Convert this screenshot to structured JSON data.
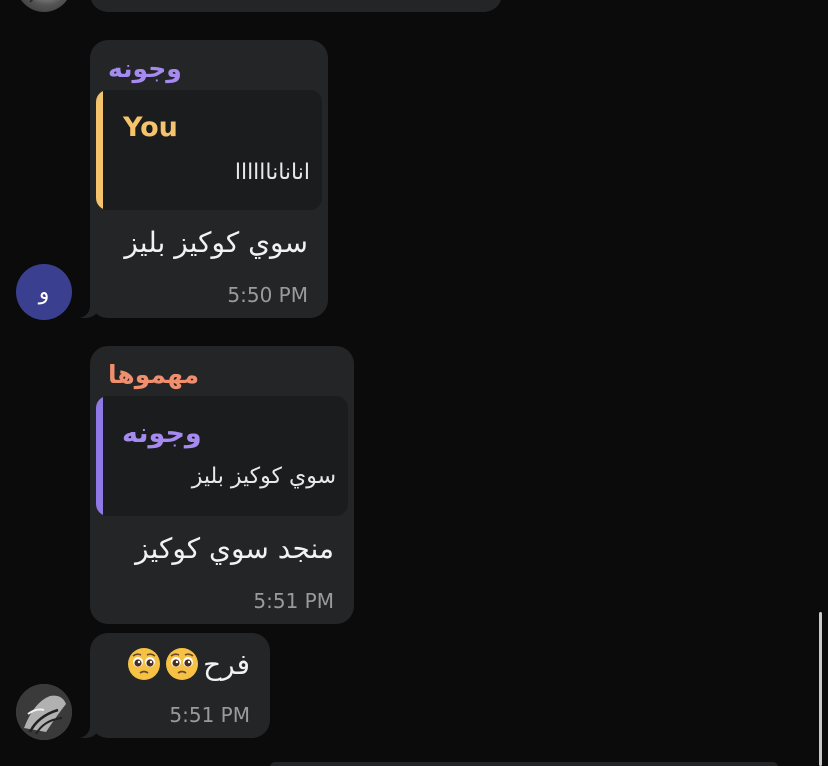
{
  "colors": {
    "background": "#0b0b0c",
    "bubble": "#242527",
    "quote_bg": "#1b1c1e",
    "sender_wajuna": "#a58bf0",
    "sender_mahmuha": "#f08f6e",
    "reply_you": "#f4c36b",
    "reply_bar_you": "#f4c36b",
    "reply_bar_wajuna": "#8f79e6",
    "time": "#9a9a9e"
  },
  "messages": [
    {
      "sender": "وجونه",
      "reply_to": {
        "name": "You",
        "text": "اناناناااااا"
      },
      "text": "سوي كوكيز بليز",
      "time": "5:50 PM",
      "avatar_letter": "و"
    },
    {
      "sender": "مهموها",
      "reply_to": {
        "name": "وجونه",
        "text": "سوي كوكيز بليز"
      },
      "text": "منجد سوي كوكيز",
      "time": "5:51 PM"
    },
    {
      "text": "فرح",
      "emoji": [
        "pleading-face",
        "pleading-face"
      ],
      "time": "5:51 PM",
      "avatar": "photo"
    }
  ]
}
